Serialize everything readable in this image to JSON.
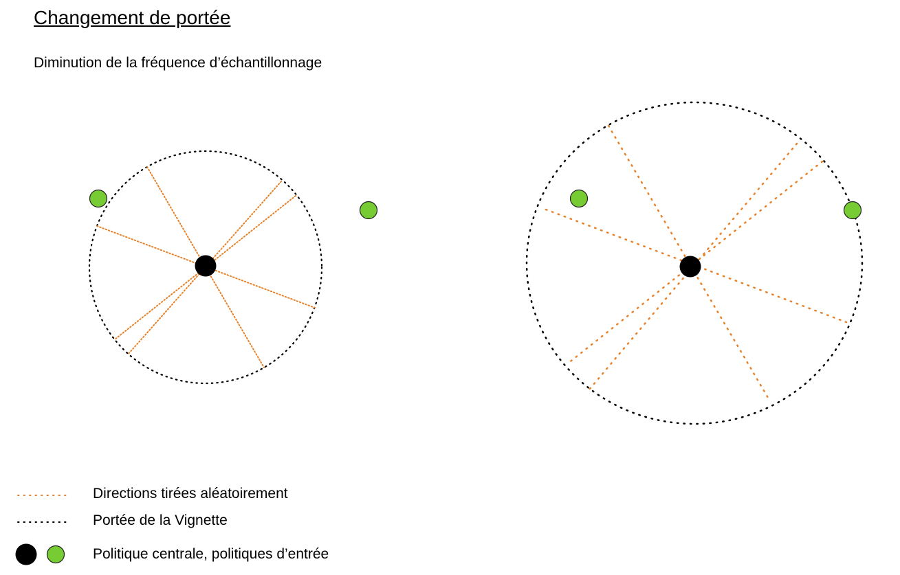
{
  "title": "Changement de portée",
  "subtitle": "Diminution de la fréquence d’échantillonnage",
  "colors": {
    "direction": "#e8822a",
    "range": "#000000",
    "central": "#000000",
    "input": "#77cc33",
    "input_stroke": "#222222"
  },
  "legend": {
    "directions": "Directions tirées aléatoirement",
    "range": "Portée de la Vignette",
    "policies": "Politique centrale, politiques d’entrée"
  }
}
